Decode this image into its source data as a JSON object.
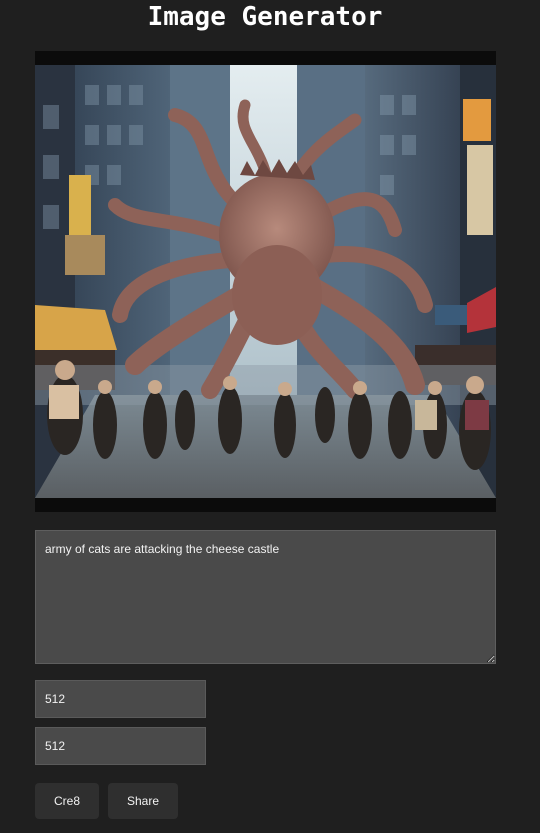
{
  "app": {
    "title": "Image Generator"
  },
  "image": {
    "kind": "generated-image"
  },
  "form": {
    "prompt": "army of cats are attacking the cheese castle",
    "width": "512",
    "height": "512"
  },
  "buttons": {
    "create": "Cre8",
    "share": "Share"
  }
}
